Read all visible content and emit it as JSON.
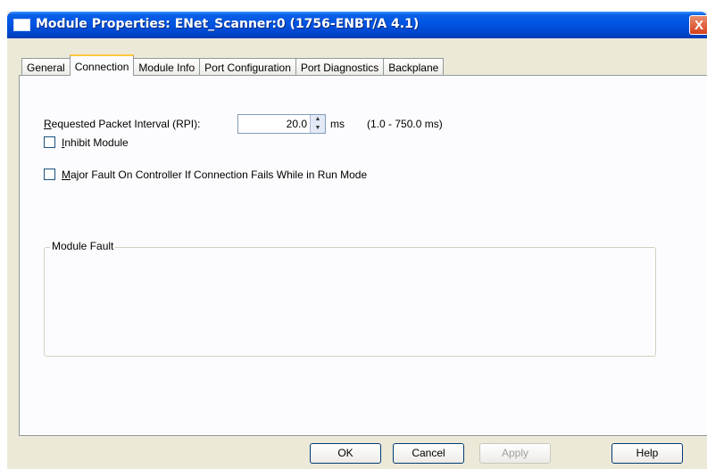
{
  "window": {
    "title": "Module Properties: ENet_Scanner:0 (1756-ENBT/A 4.1)",
    "close_glyph": "X"
  },
  "tabs": [
    {
      "label": "General",
      "active": false
    },
    {
      "label": "Connection",
      "active": true
    },
    {
      "label": "Module Info",
      "active": false
    },
    {
      "label": "Port Configuration",
      "active": false
    },
    {
      "label": "Port Diagnostics",
      "active": false
    },
    {
      "label": "Backplane",
      "active": false
    }
  ],
  "connection": {
    "rpi": {
      "label_mnemonic": "R",
      "label_rest": "equested Packet Interval (RPI):",
      "value": "20.0",
      "unit": "ms",
      "range": "(1.0 - 750.0 ms)"
    },
    "inhibit": {
      "mnemonic": "I",
      "rest": "nhibit Module",
      "checked": false
    },
    "major_fault": {
      "mnemonic": "M",
      "rest": "ajor Fault On Controller If Connection Fails While in Run Mode",
      "checked": false
    },
    "module_fault": {
      "title": "Module Fault",
      "text": ""
    }
  },
  "buttons": {
    "ok": "OK",
    "cancel": "Cancel",
    "apply": "Apply",
    "help": "Help"
  },
  "icons": {
    "window_icon": "window-icon",
    "spin_up": "▲",
    "spin_down": "▼"
  },
  "colors": {
    "titlebar": "#0054e3",
    "dialog_bg": "#ece9d8",
    "active_tab_accent": "#ffc83c"
  }
}
